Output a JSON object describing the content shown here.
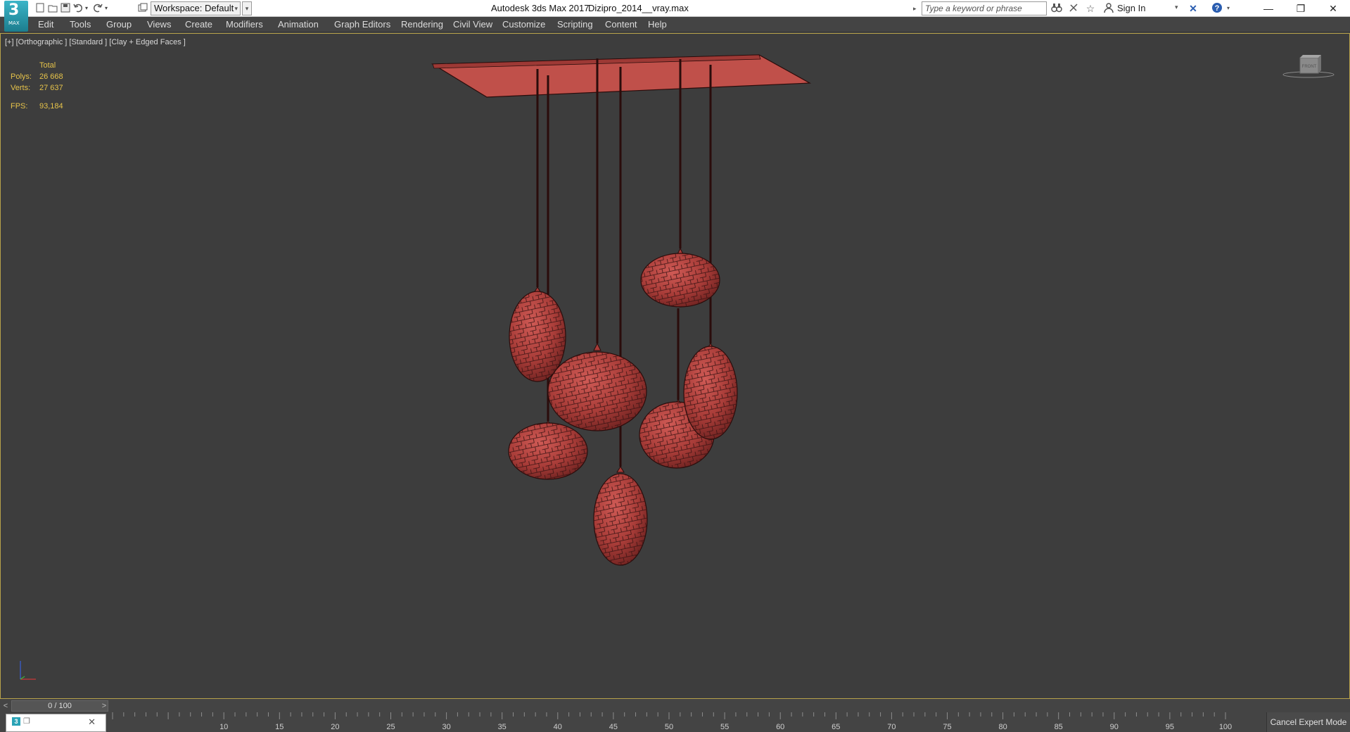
{
  "titlebar": {
    "logo_text": "3",
    "logo_sub": "MAX",
    "workspace_label": "Workspace: Default",
    "app_title": "Autodesk 3ds Max 2017",
    "doc_title": "Dizipro_2014__vray.max",
    "search_placeholder": "Type a keyword or phrase",
    "sign_in": "Sign In",
    "icons": [
      "new-file-icon",
      "open-file-icon",
      "save-icon",
      "undo-icon",
      "redo-icon",
      "project-folder-icon",
      "binoculars-icon",
      "communication-icon",
      "favorites-star-icon",
      "user-icon",
      "exchange-x-icon",
      "help-icon"
    ]
  },
  "menu": {
    "items": [
      "Edit",
      "Tools",
      "Group",
      "Views",
      "Create",
      "Modifiers",
      "Animation",
      "Graph Editors",
      "Rendering",
      "Civil View",
      "Customize",
      "Scripting",
      "Content",
      "Help"
    ]
  },
  "viewport": {
    "label": "[+] [Orthographic ] [Standard ] [Clay + Edged Faces ]",
    "stats": {
      "header": "Total",
      "polys_label": "Polys:",
      "polys_value": "26 668",
      "verts_label": "Verts:",
      "verts_value": "27 637",
      "fps_label": "FPS:",
      "fps_value": "93,184"
    },
    "viewcube_label": "FRONT",
    "model_color": "#b5433f",
    "canopy_color": "#c0504a",
    "stats_color": "#e6c34a",
    "border_color": "#b7a14a"
  },
  "timeline": {
    "frame_display": "0 / 100",
    "prev_label": "<",
    "next_label": ">",
    "ticks": [
      "10",
      "15",
      "20",
      "25",
      "30",
      "35",
      "40",
      "45",
      "50",
      "55",
      "60",
      "65",
      "70",
      "75",
      "80",
      "85",
      "90",
      "95",
      "100"
    ],
    "expert_mode_button": "Cancel Expert Mode"
  }
}
